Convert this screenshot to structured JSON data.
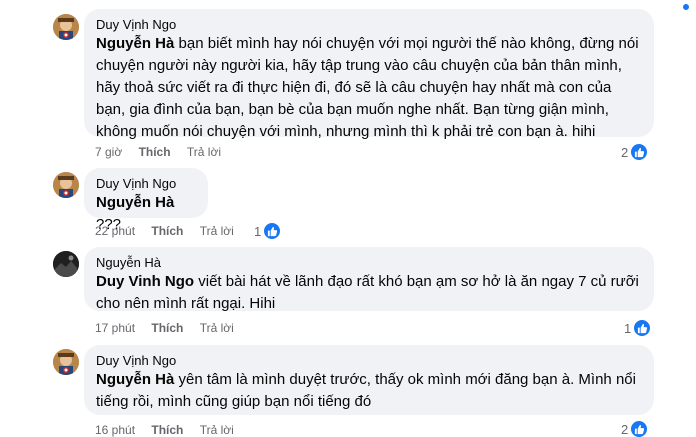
{
  "comments": [
    {
      "author": "Duy Vịnh Ngo",
      "mention": "Nguyễn Hà",
      "body": " bạn biết mình hay nói chuyện với mọi người thế nào không, đừng nói chuyện người này người kia, hãy tập trung vào câu chuyện của bản thân mình, hãy thoả sức viết ra đi thực hiện đi, đó sẽ là câu chuyện hay nhất mà con của bạn, gia đình của bạn, bạn bè của bạn muốn nghe nhất. Bạn từng giận mình, không muốn nói chuyện với mình, nhưng mình thì k phải trẻ con bạn à. hihi",
      "time": "7 giờ",
      "like": "Thích",
      "reply": "Trả lời",
      "reactions": "2"
    },
    {
      "author": "Duy Vịnh Ngo",
      "mention": "Nguyễn Hà",
      "body": " ???",
      "time": "22 phút",
      "like": "Thích",
      "reply": "Trả lời",
      "reactions": "1"
    },
    {
      "author": "Nguyễn Hà",
      "mention": "Duy Vinh Ngo",
      "body": " viết bài hát về lãnh đạo rất khó bạn ạm sơ hở là ăn ngay 7 củ rưỡi cho nên mình rất ngại. Hihi",
      "time": "17 phút",
      "like": "Thích",
      "reply": "Trả lời",
      "reactions": "1"
    },
    {
      "author": "Duy Vịnh Ngo",
      "mention": "Nguyễn Hà",
      "body": " yên tâm là mình duyệt trước, thấy ok mình mới đăng bạn à. Mình nổi tiếng rồi, mình cũng giúp bạn nổi tiếng đó",
      "time": "16 phút",
      "like": "Thích",
      "reply": "Trả lời",
      "reactions": "2"
    }
  ],
  "colors": {
    "bubble": "#f0f2f5",
    "meta": "#65676b",
    "like_reaction": "#1877f2"
  },
  "icons": {
    "reaction": "thumbs-up-icon",
    "avatar_duy": "avatar-captain-america-icon",
    "avatar_ha": "avatar-dark-photo-icon"
  }
}
